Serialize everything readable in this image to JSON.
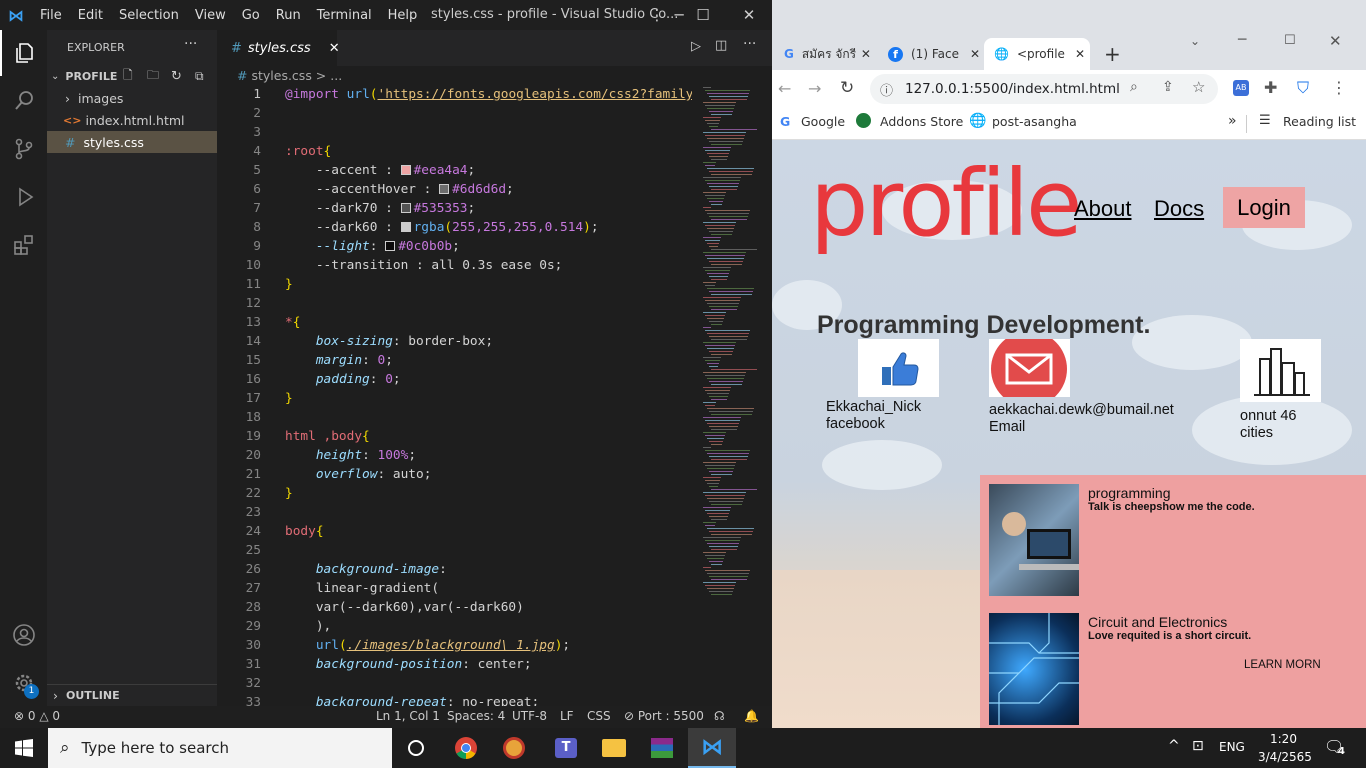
{
  "vscode": {
    "menu": [
      "File",
      "Edit",
      "Selection",
      "View",
      "Go",
      "Run",
      "Terminal",
      "Help"
    ],
    "window_title": "styles.css - profile - Visual Studio Co...",
    "explorer_label": "EXPLORER",
    "project": "PROFILE",
    "files": [
      "images",
      "index.html.html",
      "styles.css"
    ],
    "outline_label": "OUTLINE",
    "active_tab": "styles.css",
    "breadcrumb": "styles.css > ...",
    "settings_badge": "1",
    "code_lines": [
      "@import url('https://fonts.googleapis.com/css2?family-",
      "",
      "",
      ":root{",
      "    --accent : #eea4a4;",
      "    --accentHover : #6d6d6d;",
      "    --dark70 : #535353;",
      "    --dark60 : rgba(255,255,255,0.514);",
      "    --light: #0c0b0b;",
      "    --transition : all 0.3s ease 0s;",
      "}",
      "",
      "*{",
      "    box-sizing: border-box;",
      "    margin: 0;",
      "    padding: 0;",
      "}",
      "",
      "html ,body{",
      "    height: 100%;",
      "    overflow: auto;",
      "}",
      "",
      "body{",
      "",
      "    background-image:",
      "    linear-gradient(",
      "    var(--dark60),var(--dark60)",
      "    ),",
      "    url(./images/blackground\\ 1.jpg);",
      "    background-position: center;",
      "",
      "    background-repeat: no-repeat;"
    ],
    "status": {
      "problems": "0",
      "warnings": "0",
      "position": "Ln 1, Col 1",
      "spaces": "Spaces: 4",
      "encoding": "UTF-8",
      "eol": "LF",
      "language": "CSS",
      "port": "Port : 5500"
    },
    "colors": {
      "accent": "#eea4a4",
      "accentHover": "#6d6d6d",
      "dark70": "#535353",
      "dark60": "rgba(255,255,255,0.514)",
      "light": "#0c0b0b"
    }
  },
  "chrome": {
    "tabs": [
      {
        "label": "สมัคร จักรี",
        "icon": "google-icon"
      },
      {
        "label": "(1) Face",
        "icon": "facebook-icon"
      },
      {
        "label": "<profile",
        "icon": "globe-icon"
      }
    ],
    "url": "127.0.0.1:5500/index.html.html",
    "bookmarks": [
      "Google",
      "Addons Store",
      "post-asangha"
    ],
    "reading_list": "Reading list"
  },
  "site": {
    "logo": "profile",
    "nav": [
      "About",
      "Docs"
    ],
    "login": "Login",
    "heading": "Programming Development.",
    "cards": [
      {
        "line1": "Ekkachai_Nick",
        "line2": "facebook",
        "icon": "thumbs-up-icon"
      },
      {
        "line1": "aekkachai.dewk@bumail.net",
        "line2": "Email",
        "icon": "envelope-icon"
      },
      {
        "line1": "onnut 46",
        "line2": "cities",
        "icon": "city-icon"
      }
    ],
    "posts": [
      {
        "title": "programming",
        "subtitle": "Talk is cheepshow me the code."
      },
      {
        "title": "Circuit and Electronics",
        "subtitle": "Love requited is a short circuit.",
        "link": "LEARN MORN"
      }
    ],
    "accent": "#eea4a4",
    "logo_color": "#e8383d"
  },
  "taskbar": {
    "search_placeholder": "Type here to search",
    "language": "ENG",
    "time": "1:20",
    "date": "3/4/2565",
    "notification_count": "4"
  }
}
